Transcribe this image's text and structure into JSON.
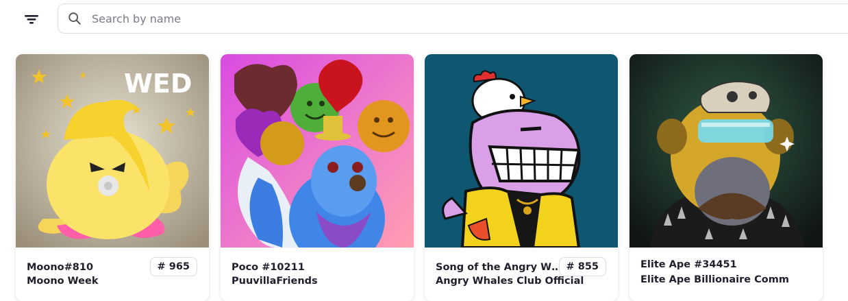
{
  "search": {
    "placeholder": "Search by name"
  },
  "cards": [
    {
      "name": "Moono#810",
      "collection": "Moono Week",
      "rank": "# 965",
      "badge_text": "WED"
    },
    {
      "name": "Poco #10211",
      "collection": "PuuvillaFriends",
      "rank": ""
    },
    {
      "name": "Song of the Angry Whal...",
      "collection": "Angry Whales Club Official",
      "rank": "# 855"
    },
    {
      "name": "Elite Ape #34451",
      "collection": "Elite Ape Billionaire Comm",
      "rank": ""
    }
  ]
}
